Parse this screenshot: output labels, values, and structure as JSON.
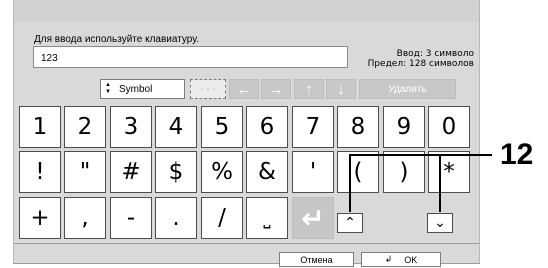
{
  "prompt": "Для ввода используйте клавиатуру.",
  "input_value": "123",
  "count": {
    "line1": "Ввод: 3 символо",
    "line2": "Предел: 128 символов"
  },
  "toolbar": {
    "mode_label": "Symbol",
    "placeholder_button": "- - -",
    "left_arrow": "←",
    "right_arrow": "→",
    "up_arrow": "↑",
    "down_arrow": "↓",
    "delete_label": "Удалить"
  },
  "keys": {
    "row1": [
      "1",
      "2",
      "3",
      "4",
      "5",
      "6",
      "7",
      "8",
      "9",
      "0"
    ],
    "row2": [
      "!",
      "\"",
      "#",
      "$",
      "%",
      "&",
      "'",
      "(",
      ")",
      "*"
    ],
    "row3": [
      "+",
      ",",
      "-",
      ".",
      "/",
      "⎵",
      "↵"
    ]
  },
  "scroll": {
    "up": "⌃",
    "down": "⌄"
  },
  "buttons": {
    "cancel": "Отмена",
    "ok": "OK",
    "ok_icon": "↲"
  },
  "annotation": {
    "callout_number": "12"
  }
}
